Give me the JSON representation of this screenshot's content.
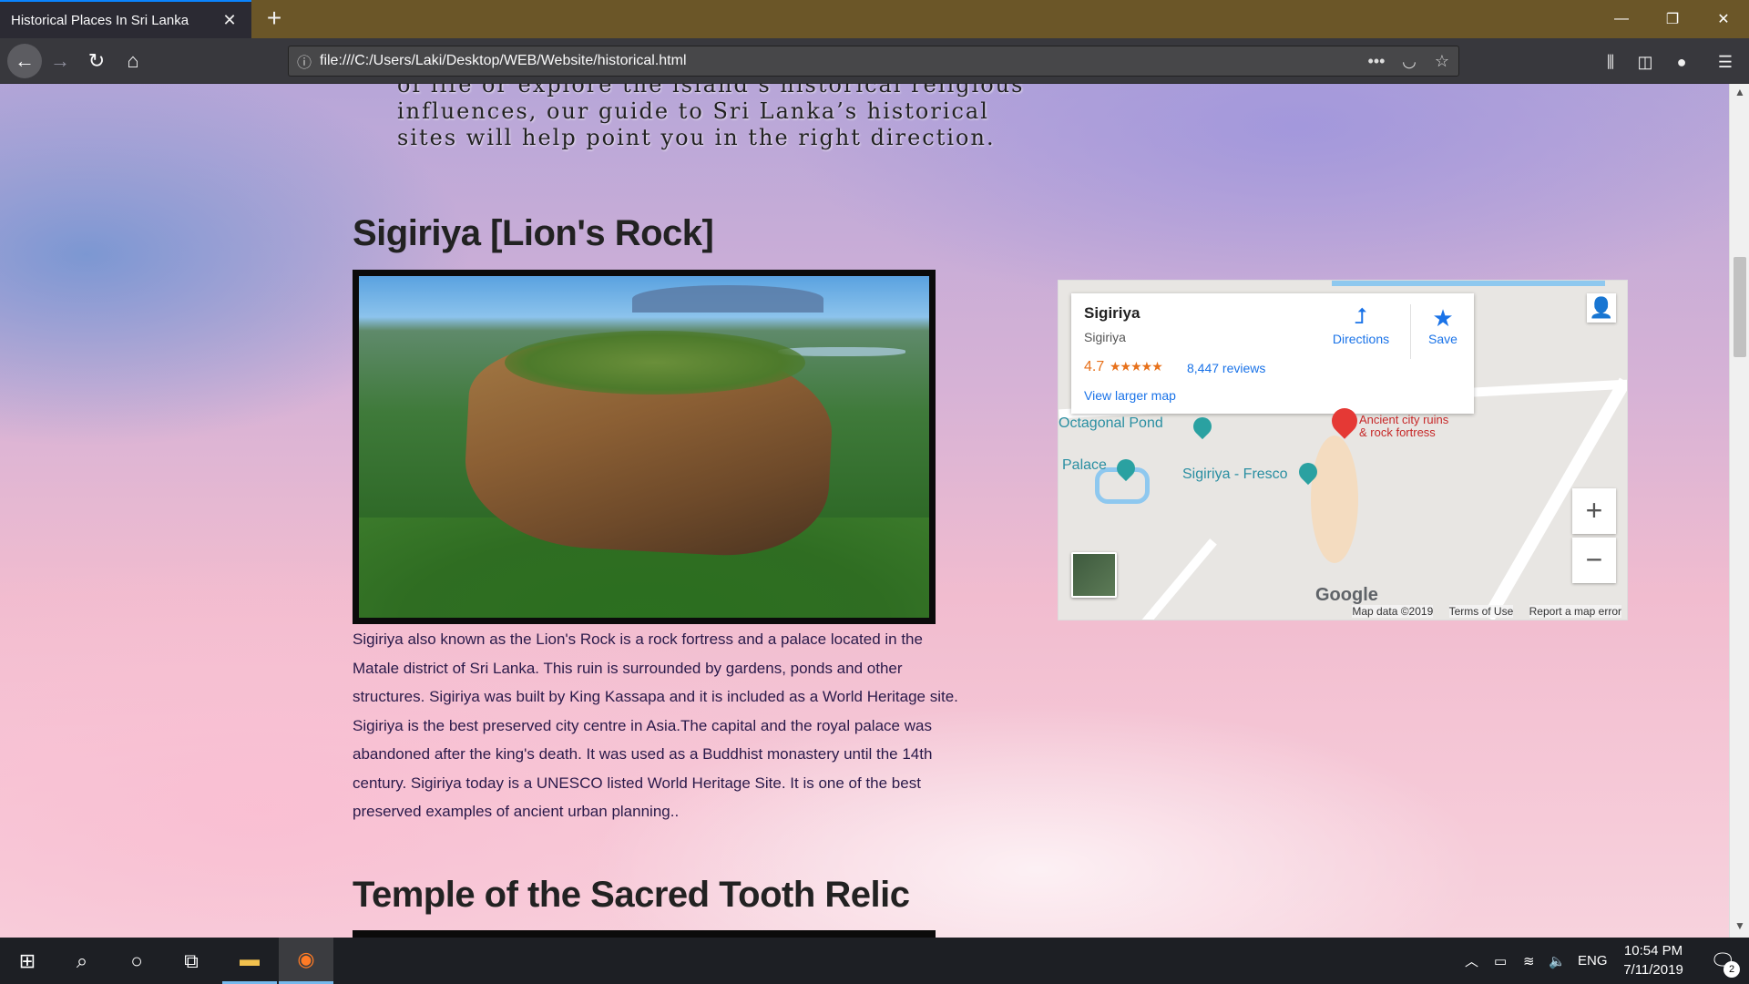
{
  "browser": {
    "tab_title": "Historical Places In Sri Lanka",
    "tab_close": "✕",
    "new_tab": "+",
    "url": "file:///C:/Users/Laki/Desktop/WEB/Website/historical.html",
    "window": {
      "minimize": "—",
      "restore": "❐",
      "close": "✕"
    }
  },
  "page": {
    "intro_text": "of life or explore the island’s historical religious influences, our guide to Sri Lanka’s historical sites will help point you in the right direction.",
    "sections": [
      {
        "heading": "Sigiriya [Lion's Rock]",
        "description": "Sigiriya also known as the Lion's Rock is a rock fortress and a palace located in the Matale district of Sri Lanka. This ruin is surrounded by gardens, ponds and other structures. Sigiriya was built by King Kassapa and it is included as a World Heritage site. Sigiriya is the best preserved city centre in Asia.The capital and the royal palace was abandoned after the king's death. It was used as a Buddhist monastery until the 14th century. Sigiriya today is a UNESCO listed World Heritage Site. It is one of the best preserved examples of ancient urban planning.."
      },
      {
        "heading": "Temple of the Sacred Tooth Relic"
      }
    ]
  },
  "map": {
    "place_name": "Sigiriya",
    "address": "Sigiriya",
    "rating": "4.7",
    "stars": "★★★★★",
    "reviews": "8,447 reviews",
    "view_larger": "View larger map",
    "directions_label": "Directions",
    "save_label": "Save",
    "labels": {
      "octagonal_pond": "Octagonal Pond",
      "palace": "Palace",
      "fresco": "Sigiriya - Fresco",
      "sigiriya_pin": "Sigiriya",
      "pin_subtitle_1": "Ancient city ruins",
      "pin_subtitle_2": "& rock fortress"
    },
    "zoom_in": "+",
    "zoom_out": "−",
    "google_logo": "Google",
    "map_data": "Map data ©2019",
    "terms": "Terms of Use",
    "report": "Report a map error"
  },
  "taskbar": {
    "language": "ENG",
    "time": "10:54 PM",
    "date": "7/11/2019",
    "notification_count": "2"
  }
}
